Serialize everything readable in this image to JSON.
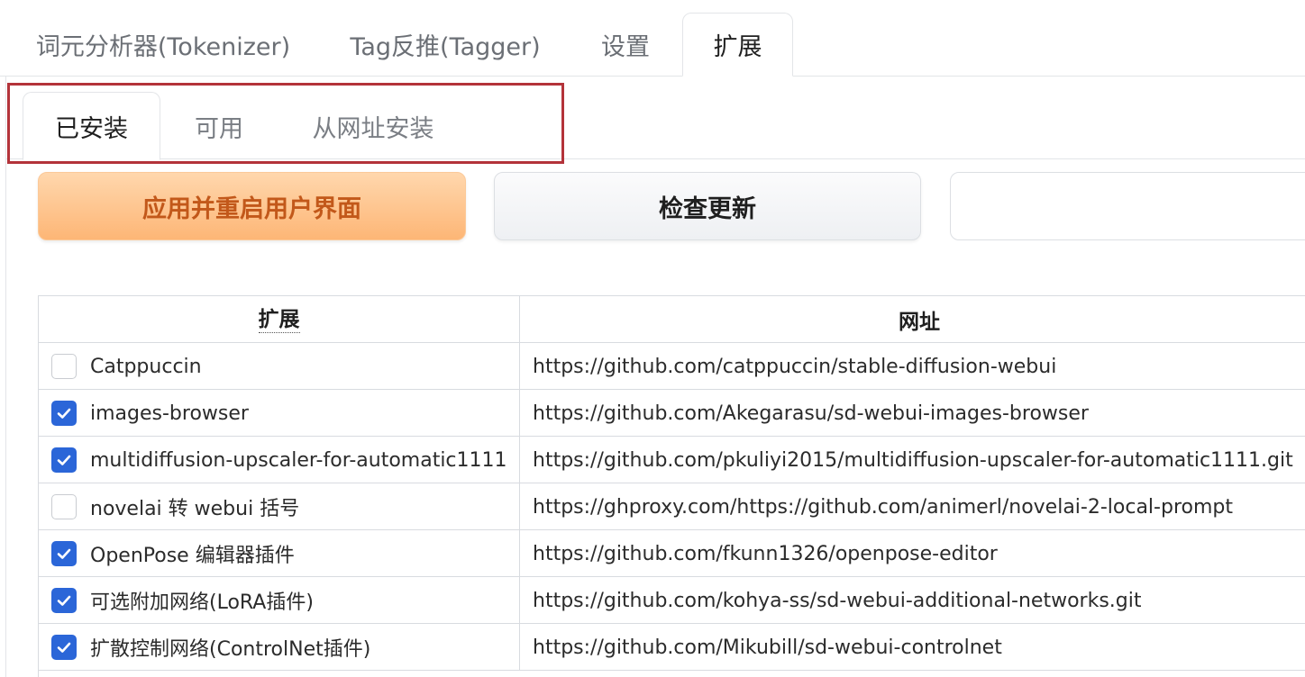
{
  "top_tabs": [
    {
      "label": "词元分析器(Tokenizer)",
      "active": false
    },
    {
      "label": "Tag反推(Tagger)",
      "active": false
    },
    {
      "label": "设置",
      "active": false
    },
    {
      "label": "扩展",
      "active": true
    }
  ],
  "sub_tabs": [
    {
      "label": "已安装",
      "active": true
    },
    {
      "label": "可用",
      "active": false
    },
    {
      "label": "从网址安装",
      "active": false
    }
  ],
  "buttons": {
    "apply_label": "应用并重启用户界面",
    "check_label": "检查更新"
  },
  "colors": {
    "highlight_box": "#b3333a",
    "apply_button_text": "#c2581a",
    "checkbox_checked": "#2b66d8"
  },
  "table": {
    "headers": {
      "extension": "扩展",
      "url": "网址"
    },
    "rows": [
      {
        "checked": false,
        "name": "Catppuccin",
        "url": "https://github.com/catppuccin/stable-diffusion-webui"
      },
      {
        "checked": true,
        "name": "images-browser",
        "url": "https://github.com/Akegarasu/sd-webui-images-browser"
      },
      {
        "checked": true,
        "name": "multidiffusion-upscaler-for-automatic1111",
        "url": "https://github.com/pkuliyi2015/multidiffusion-upscaler-for-automatic1111.git"
      },
      {
        "checked": false,
        "name": "novelai 转 webui 括号",
        "url": "https://ghproxy.com/https://github.com/animerl/novelai-2-local-prompt"
      },
      {
        "checked": true,
        "name": "OpenPose 编辑器插件",
        "url": "https://github.com/fkunn1326/openpose-editor"
      },
      {
        "checked": true,
        "name": "可选附加网络(LoRA插件)",
        "url": "https://github.com/kohya-ss/sd-webui-additional-networks.git"
      },
      {
        "checked": true,
        "name": "扩散控制网络(ControlNet插件)",
        "url": "https://github.com/Mikubill/sd-webui-controlnet"
      }
    ]
  }
}
